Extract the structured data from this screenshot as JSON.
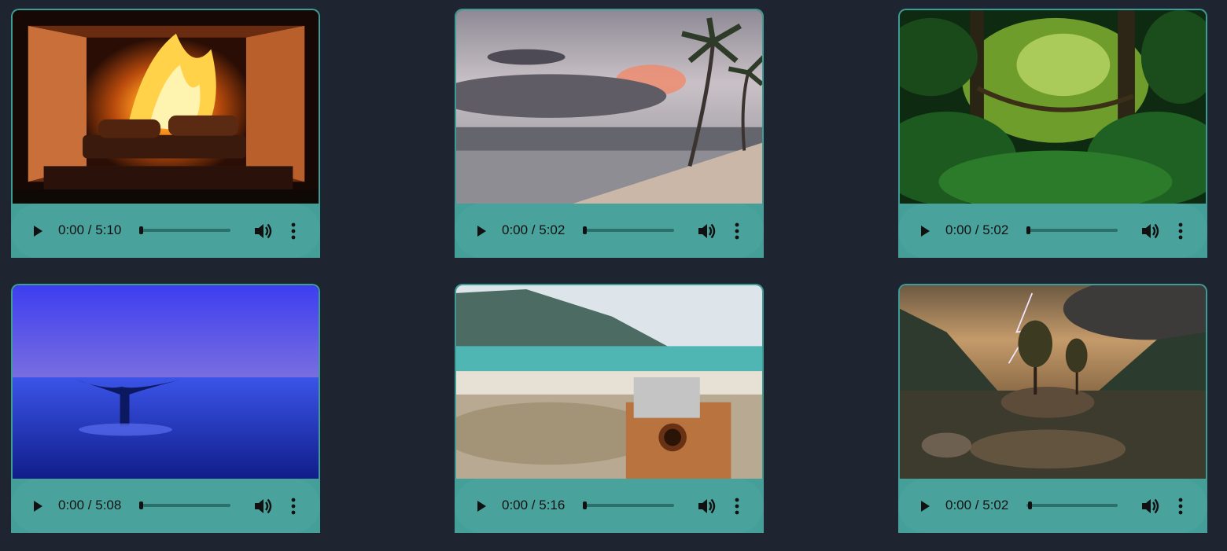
{
  "players": [
    {
      "scene": "fireplace",
      "time_label": "0:00 / 5:10",
      "progress": 0
    },
    {
      "scene": "beach-palms",
      "time_label": "0:00 / 5:02",
      "progress": 0
    },
    {
      "scene": "jungle",
      "time_label": "0:00 / 5:02",
      "progress": 0
    },
    {
      "scene": "whale-tail",
      "time_label": "0:00 / 5:08",
      "progress": 0
    },
    {
      "scene": "kalimba-beach",
      "time_label": "0:00 / 5:16",
      "progress": 0
    },
    {
      "scene": "lake-lightning",
      "time_label": "0:00 / 5:02",
      "progress": 0.02
    }
  ],
  "icons": {
    "play": "play-icon",
    "volume": "volume-icon",
    "menu": "more-vertical-icon"
  },
  "colors": {
    "background": "#1f2530",
    "player": "#4aa29c",
    "card_border": "#3d9c96"
  }
}
